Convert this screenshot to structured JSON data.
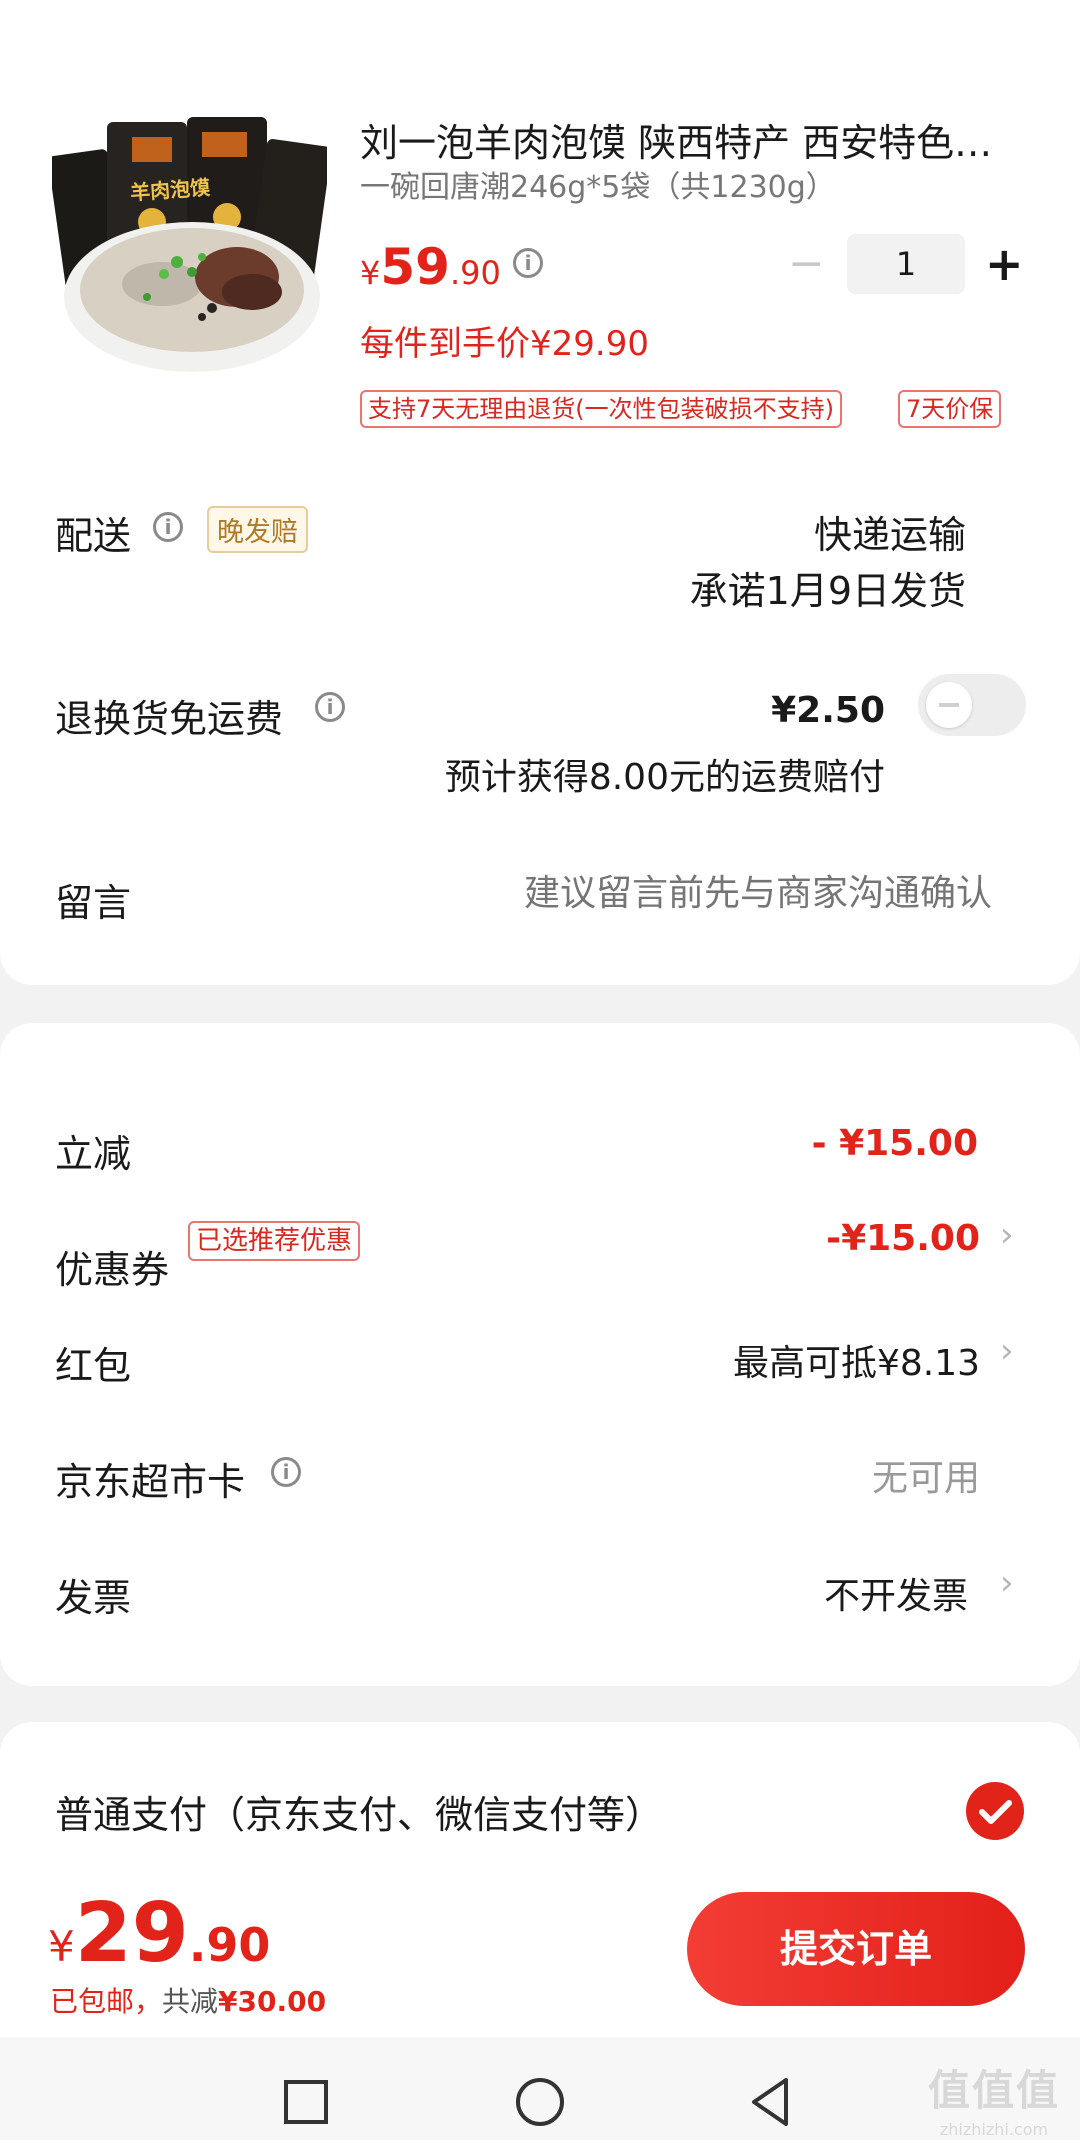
{
  "product": {
    "title": "刘一泡羊肉泡馍 陕西特产 西安特色…",
    "spec": "一碗回唐潮246g*5袋（共1230g）",
    "price_symbol": "¥",
    "price_int": "59",
    "price_dec": ".90",
    "quantity": "1",
    "unit_price_label": "每件到手价¥29.90",
    "tags": [
      "支持7天无理由退货(一次性包装破损不支持)",
      "7天价保"
    ],
    "image_text": "羊肉泡馍"
  },
  "delivery": {
    "label": "配送",
    "badge": "晚发赔",
    "method": "快递运输",
    "promise": "承诺1月9日发货"
  },
  "return_shipping": {
    "label": "退换货免运费",
    "price": "¥2.50",
    "note": "预计获得8.00元的运费赔付"
  },
  "message": {
    "label": "留言",
    "placeholder": "建议留言前先与商家沟通确认"
  },
  "discounts": {
    "instant": {
      "label": "立减",
      "value": "- ¥15.00"
    },
    "coupon": {
      "label": "优惠券",
      "badge": "已选推荐优惠",
      "value": "-¥15.00"
    },
    "redpacket": {
      "label": "红包",
      "value": "最高可抵¥8.13"
    },
    "card": {
      "label": "京东超市卡",
      "value": "无可用"
    },
    "invoice": {
      "label": "发票",
      "value": "不开发票"
    }
  },
  "payment": {
    "label": "普通支付（京东支付、微信支付等）"
  },
  "footer": {
    "price_symbol": "¥",
    "price_int": "29",
    "price_dec": ".90",
    "shipping_note": "已包邮，",
    "saved_label": "共减",
    "saved_value": "¥30.00",
    "submit_label": "提交订单"
  },
  "watermark": {
    "main": "值值值",
    "sub": "zhizhizhi.com"
  },
  "colors": {
    "accent": "#e2231a",
    "submit_gradient_start": "#f23d35",
    "submit_gradient_end": "#e3201a"
  }
}
